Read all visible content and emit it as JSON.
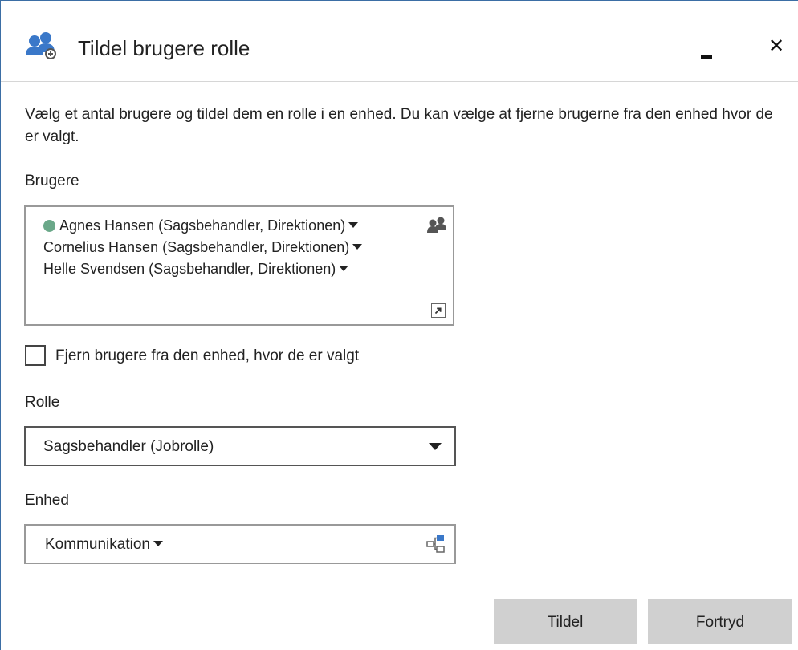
{
  "dialog": {
    "title": "Tildel brugere rolle",
    "title_icon": "users-role-icon",
    "minimize_icon": "minimize-icon",
    "close_glyph": "✕"
  },
  "description": "Vælg et antal brugere og tildel dem en rolle i en enhed. Du kan vælge at fjerne brugerne fra den enhed hvor de er valgt.",
  "users": {
    "label": "Brugere",
    "items": [
      {
        "name": "Agnes Hansen (Sagsbehandler, Direktionen)",
        "status": "online"
      },
      {
        "name": "Cornelius Hansen (Sagsbehandler, Direktionen)"
      },
      {
        "name": "Helle Svendsen (Sagsbehandler, Direktionen)"
      }
    ],
    "status_color": "#6aa889"
  },
  "remove_checkbox": {
    "label": "Fjern brugere fra den enhed, hvor de er valgt",
    "checked": false
  },
  "role": {
    "label": "Rolle",
    "value": "Sagsbehandler (Jobrolle)"
  },
  "unit": {
    "label": "Enhed",
    "value": "Kommunikation"
  },
  "buttons": {
    "assign": "Tildel",
    "cancel": "Fortryd"
  },
  "colors": {
    "accent": "#3b6ea5",
    "button_bg": "#d0d0d0",
    "icon_blue": "#3a78c9"
  }
}
